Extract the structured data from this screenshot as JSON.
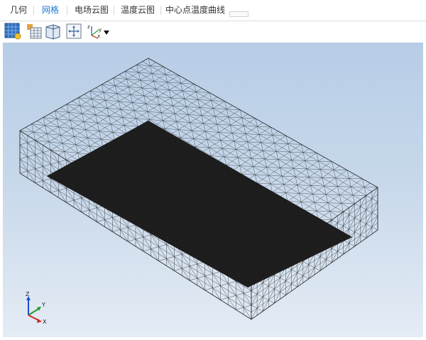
{
  "tabs": [
    {
      "label": "几何",
      "active": false
    },
    {
      "label": "网格",
      "active": true
    },
    {
      "label": "电场云图",
      "active": false
    },
    {
      "label": "温度云图",
      "active": false
    },
    {
      "label": "中心点温度曲线",
      "active": false
    }
  ],
  "toolbar": {
    "buttons": [
      {
        "icon": "mesh-generate-icon"
      },
      {
        "icon": "mesh-table-icon"
      },
      {
        "icon": "view-box-icon"
      },
      {
        "icon": "fit-view-icon"
      },
      {
        "icon": "axis-orientation-icon"
      }
    ]
  },
  "axis_triad": {
    "z": "Z",
    "y": "Y",
    "x": "X"
  },
  "colors": {
    "accent": "#1f7ad6",
    "mesh_line": "#2a2a2a",
    "background_top": "#b7cde6",
    "background_bottom": "#e4ecf5"
  }
}
